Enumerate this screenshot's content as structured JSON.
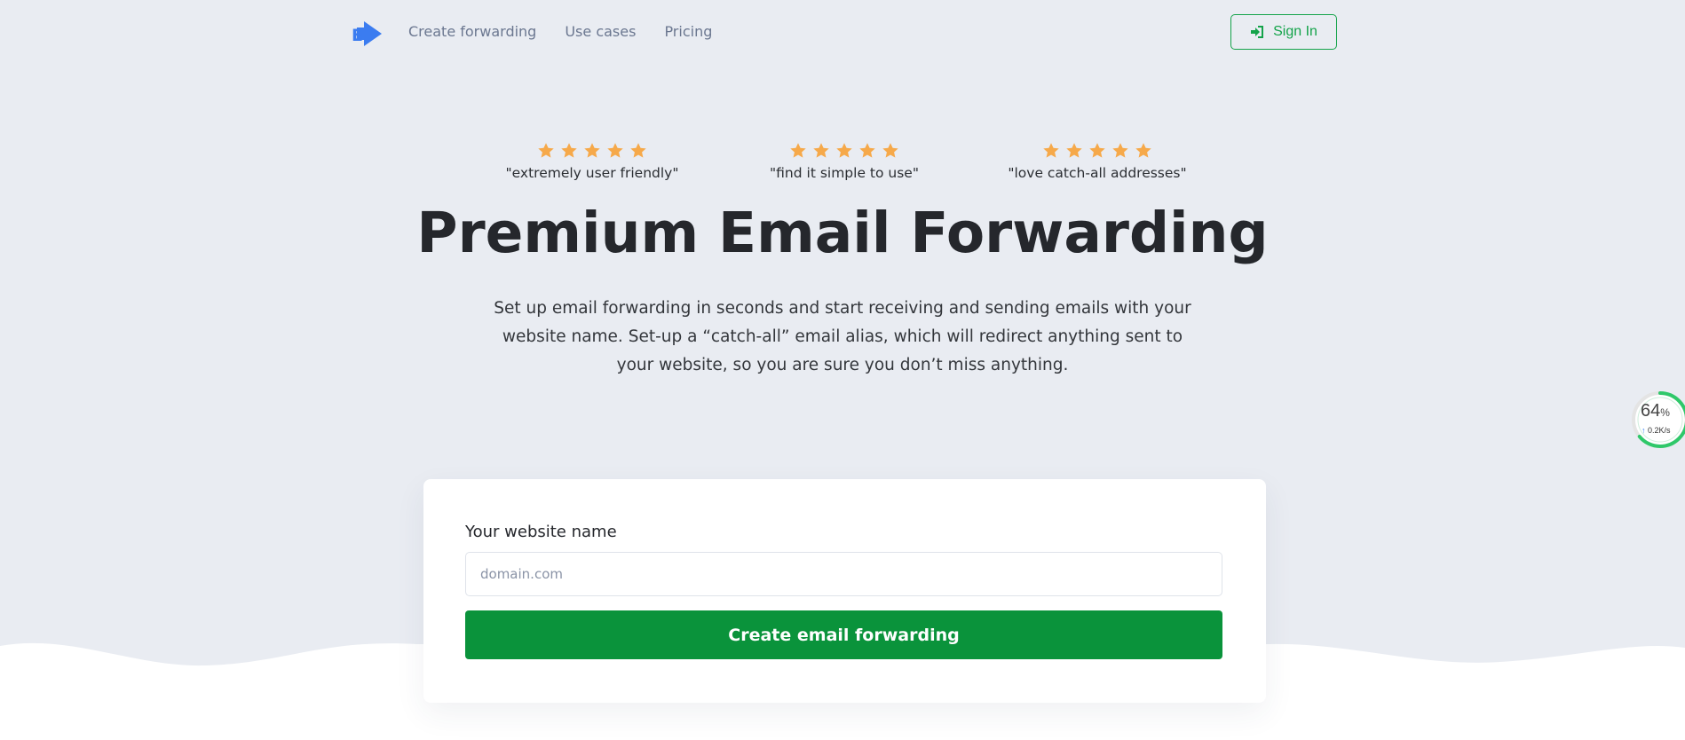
{
  "nav": {
    "logo_icon": "forward-arrow-logo-icon",
    "links": [
      "Create forwarding",
      "Use cases",
      "Pricing"
    ],
    "signin_label": "Sign In",
    "signin_icon": "sign-in-icon"
  },
  "reviews": [
    {
      "stars": 5,
      "quote": "\"extremely user friendly\""
    },
    {
      "stars": 5,
      "quote": "\"find it simple to use\""
    },
    {
      "stars": 5,
      "quote": "\"love catch-all addresses\""
    }
  ],
  "hero": {
    "title": "Premium Email Forwarding",
    "subtitle": "Set up email forwarding in seconds and start receiving and sending emails with your website name. Set-up a “catch-all” email alias, which will redirect anything sent to your website, so you are sure you don’t miss anything."
  },
  "form": {
    "label": "Your website name",
    "placeholder": "domain.com",
    "value": "",
    "button_label": "Create email forwarding"
  },
  "speed_widget": {
    "percent": "64",
    "percent_unit": "%",
    "rate_arrow": "↑",
    "rate": "0.2K/s",
    "level": 0.64
  },
  "colors": {
    "brand_green": "#0a933b",
    "sign_in_green": "#14a34a",
    "logo_blue": "#3b7cf0",
    "star_orange": "#f6a94a",
    "background": "#e9ecf2"
  }
}
